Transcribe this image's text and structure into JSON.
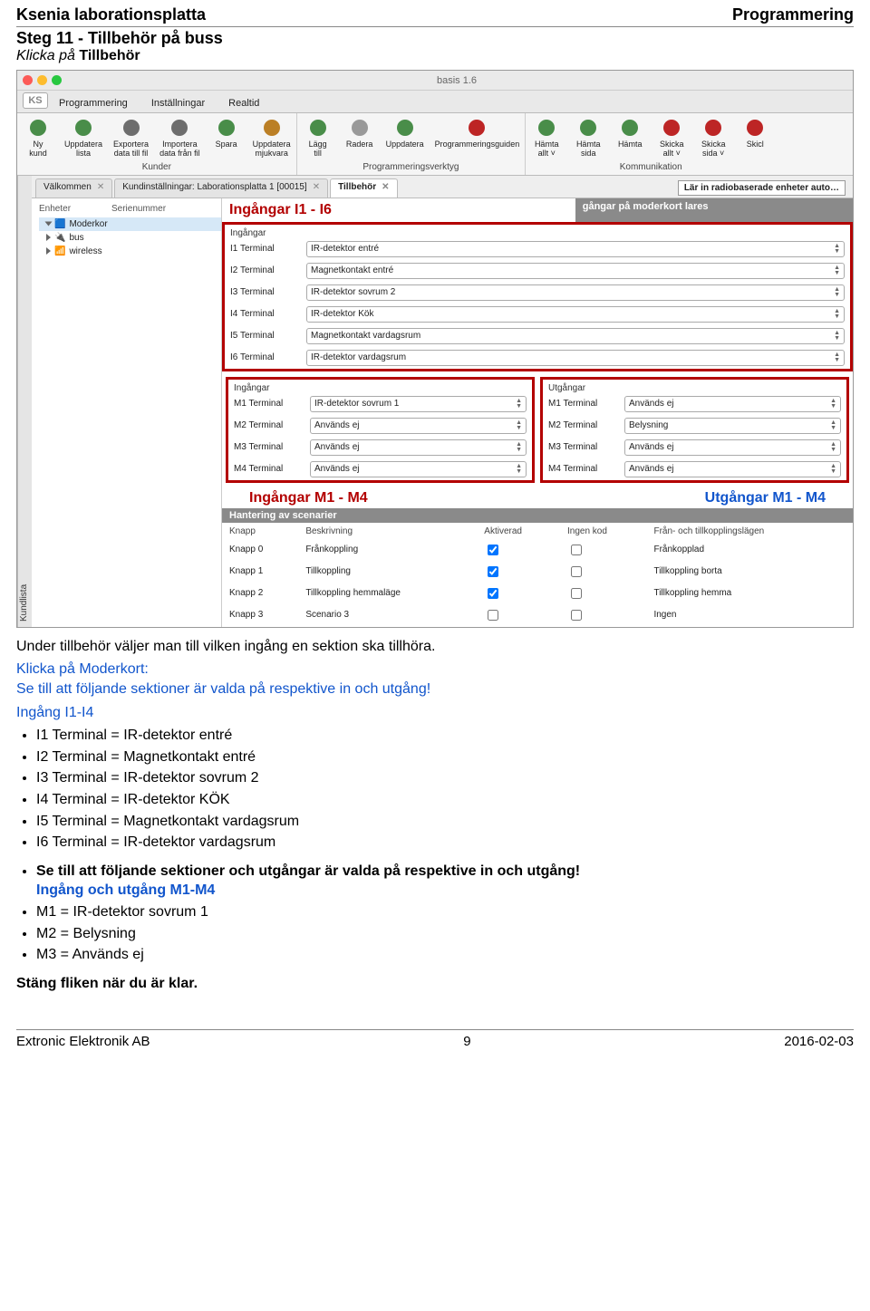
{
  "doc": {
    "title_left": "Ksenia laborationsplatta",
    "title_right": "Programmering",
    "step_title": "Steg 11 - Tillbehör på buss",
    "step_sub_prefix": "Klicka på ",
    "step_sub_bold": "Tillbehör"
  },
  "window": {
    "title": "basis 1.6"
  },
  "menubar": {
    "items": [
      "Programmering",
      "Inställningar",
      "Realtid"
    ]
  },
  "ribbon": {
    "group_kunder_label": "Kunder",
    "group_verktyg_label": "Programmeringsverktyg",
    "group_komm_label": "Kommunikation",
    "kunder": [
      {
        "label": "Ny\nkund",
        "icon": "person-plus"
      },
      {
        "label": "Uppdatera\nlista",
        "icon": "refresh"
      },
      {
        "label": "Exportera\ndata till fil",
        "icon": "export"
      },
      {
        "label": "Importera\ndata från fil",
        "icon": "import"
      },
      {
        "label": "Spara",
        "icon": "disk"
      },
      {
        "label": "Uppdatera\nmjukvara",
        "icon": "gear"
      }
    ],
    "verktyg": [
      {
        "label": "Lägg\ntill",
        "icon": "plus"
      },
      {
        "label": "Radera",
        "icon": "trash"
      },
      {
        "label": "Uppdatera",
        "icon": "refresh2"
      },
      {
        "label": "Programmeringsguiden",
        "icon": "wand"
      }
    ],
    "komm": [
      {
        "label": "Hämta\nallt ˅",
        "icon": "down"
      },
      {
        "label": "Hämta\nsida",
        "icon": "down2"
      },
      {
        "label": "Hämta",
        "icon": "down3"
      },
      {
        "label": "Skicka\nallt ˅",
        "icon": "up"
      },
      {
        "label": "Skicka\nsida ˅",
        "icon": "up2"
      },
      {
        "label": "Skicl",
        "icon": "up3"
      }
    ]
  },
  "sidetab": "Kundlista",
  "tabstrip": {
    "t1": "Välkommen",
    "t2": "Kundinställningar: Laborationsplatta 1 [00015]",
    "t3": "Tillbehör",
    "radio_btn": "Lär in radiobaserade enheter auto…"
  },
  "tree": {
    "h1": "Enheter",
    "h2": "Serienummer",
    "n1": "Moderkor",
    "n2": "bus",
    "n3": "wireless"
  },
  "callouts": {
    "i16": "Ingångar I1 - I6",
    "im": "Ingångar M1 - M4",
    "um": "Utgångar M1 - M4"
  },
  "sect_header": "gångar på moderkort lares",
  "labels": {
    "ingangar": "Ingångar",
    "utgangar": "Utgångar"
  },
  "inputsI": [
    {
      "term": "I1 Terminal",
      "val": "IR-detektor entré"
    },
    {
      "term": "I2 Terminal",
      "val": "Magnetkontakt entré"
    },
    {
      "term": "I3 Terminal",
      "val": "IR-detektor sovrum 2"
    },
    {
      "term": "I4 Terminal",
      "val": "IR-detektor Kök"
    },
    {
      "term": "I5 Terminal",
      "val": "Magnetkontakt vardagsrum"
    },
    {
      "term": "I6 Terminal",
      "val": "IR-detektor vardagsrum"
    }
  ],
  "inputsM": [
    {
      "term": "M1 Terminal",
      "val": "IR-detektor sovrum 1"
    },
    {
      "term": "M2 Terminal",
      "val": "Används ej"
    },
    {
      "term": "M3 Terminal",
      "val": "Används ej"
    },
    {
      "term": "M4 Terminal",
      "val": "Används ej"
    }
  ],
  "outputsM": [
    {
      "term": "M1 Terminal",
      "val": "Används ej"
    },
    {
      "term": "M2 Terminal",
      "val": "Belysning"
    },
    {
      "term": "M3 Terminal",
      "val": "Används ej"
    },
    {
      "term": "M4 Terminal",
      "val": "Används ej"
    }
  ],
  "hantering": {
    "header": "Hantering av scenarier",
    "cols": [
      "Knapp",
      "Beskrivning",
      "Aktiverad",
      "Ingen kod",
      "Från- och tillkopplingslägen"
    ],
    "rows": [
      {
        "k": "Knapp 0",
        "b": "Frånkoppling",
        "a": true,
        "i": false,
        "s": "Frånkopplad"
      },
      {
        "k": "Knapp 1",
        "b": "Tillkoppling",
        "a": true,
        "i": false,
        "s": "Tillkoppling borta"
      },
      {
        "k": "Knapp 2",
        "b": "Tillkoppling hemmaläge",
        "a": true,
        "i": false,
        "s": "Tillkoppling hemma"
      },
      {
        "k": "Knapp 3",
        "b": "Scenario 3",
        "a": false,
        "i": false,
        "s": "Ingen"
      }
    ]
  },
  "body": {
    "p1": "Under tillbehör väljer man till vilken ingång en sektion ska tillhöra.",
    "p2a": "Klicka på Moderkort:",
    "p2b": "Se till att följande sektioner är valda på respektive in och utgång!",
    "h1": "Ingång I1-I4",
    "l1": "I1 Terminal = IR-detektor entré",
    "l2": "I2 Terminal = Magnetkontakt entré",
    "l3": "I3 Terminal = IR-detektor sovrum 2",
    "l4": "I4 Terminal = IR-detektor KÖK",
    "l5": "I5 Terminal = Magnetkontakt vardagsrum",
    "l6": "I6 Terminal = IR-detektor vardagsrum",
    "p3": "Se till att följande sektioner och utgångar är valda på respektive in och utgång!",
    "h2": "Ingång och utgång M1-M4",
    "m1": "M1 = IR-detektor sovrum 1",
    "m2": "M2 = Belysning",
    "m3": "M3 = Används ej",
    "close": "Stäng fliken när du är klar."
  },
  "footer": {
    "left": "Extronic Elektronik AB",
    "center": "9",
    "right": "2016-02-03"
  }
}
